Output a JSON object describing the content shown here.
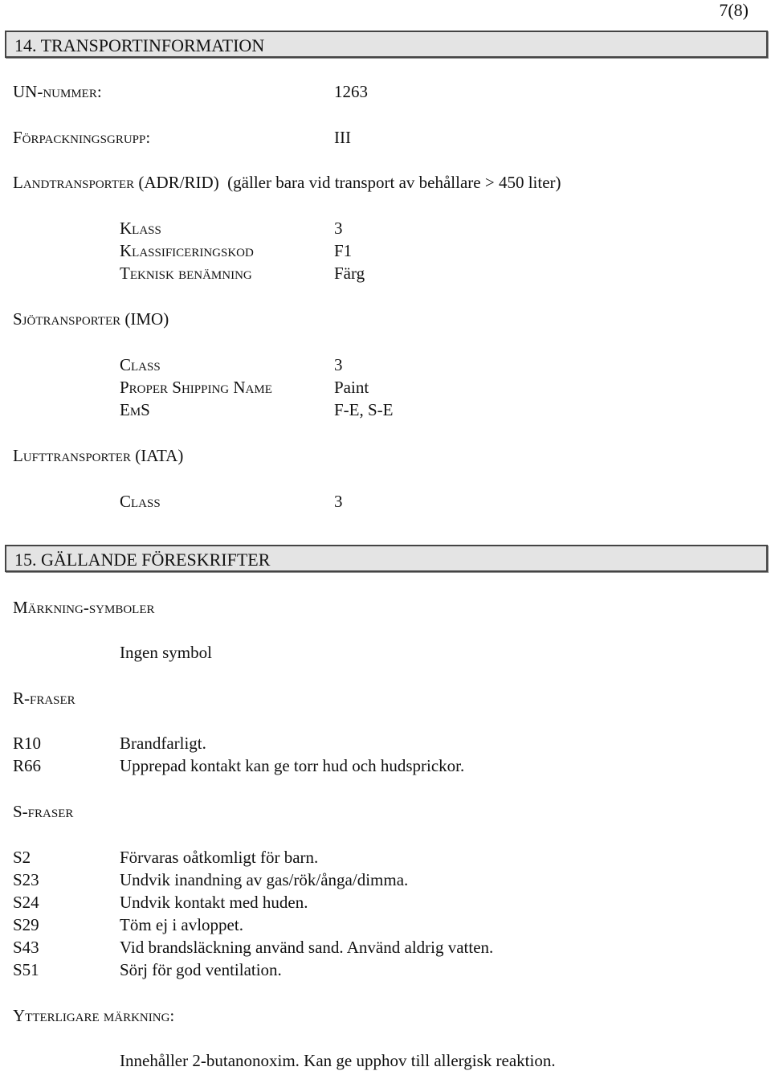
{
  "page_number": "7(8)",
  "section14": {
    "title": "14. TRANSPORTINFORMATION",
    "un_number_label": "UN-nummer:",
    "un_number_value": "1263",
    "packing_group_label": "Förpackningsgrupp:",
    "packing_group_value": "III",
    "land": {
      "label": "Landtransporter",
      "suffix": "(ADR/RID)  (gäller bara vid transport av behållare > 450 liter)",
      "rows": [
        {
          "label": "Klass",
          "value": "3"
        },
        {
          "label": "Klassificeringskod",
          "value": "F1"
        },
        {
          "label": "Teknisk benämning",
          "value": "Färg"
        }
      ]
    },
    "sea": {
      "label": "Sjötransporter",
      "suffix": "(IMO)",
      "rows": [
        {
          "label": "Class",
          "value": "3"
        },
        {
          "label": "Proper Shipping Name",
          "value": "Paint"
        },
        {
          "label": "EmS",
          "value": "F-E, S-E"
        }
      ]
    },
    "air": {
      "label": "Lufttransporter",
      "suffix": "(IATA)",
      "rows": [
        {
          "label": "Class",
          "value": "3"
        }
      ]
    }
  },
  "section15": {
    "title": "15. GÄLLANDE FÖRESKRIFTER",
    "symbols_label": "Märkning-symboler",
    "symbols_value": "Ingen symbol",
    "r_label": "R-fraser",
    "r_phrases": [
      {
        "code": "R10",
        "text": "Brandfarligt."
      },
      {
        "code": "R66",
        "text": "Upprepad kontakt kan ge torr hud och hudsprickor."
      }
    ],
    "s_label": "S-fraser",
    "s_phrases": [
      {
        "code": "S2",
        "text": "Förvaras oåtkomligt för barn."
      },
      {
        "code": "S23",
        "text": "Undvik inandning av gas/rök/ånga/dimma."
      },
      {
        "code": "S24",
        "text": "Undvik kontakt med huden."
      },
      {
        "code": "S29",
        "text": "Töm ej i avloppet."
      },
      {
        "code": "S43",
        "text": "Vid brandsläckning använd sand. Använd aldrig vatten."
      },
      {
        "code": "S51",
        "text": "Sörj för god ventilation."
      }
    ],
    "additional_label": "Ytterligare märkning:",
    "additional_text": "Innehåller 2-butanonoxim. Kan ge upphov till allergisk reaktion."
  }
}
